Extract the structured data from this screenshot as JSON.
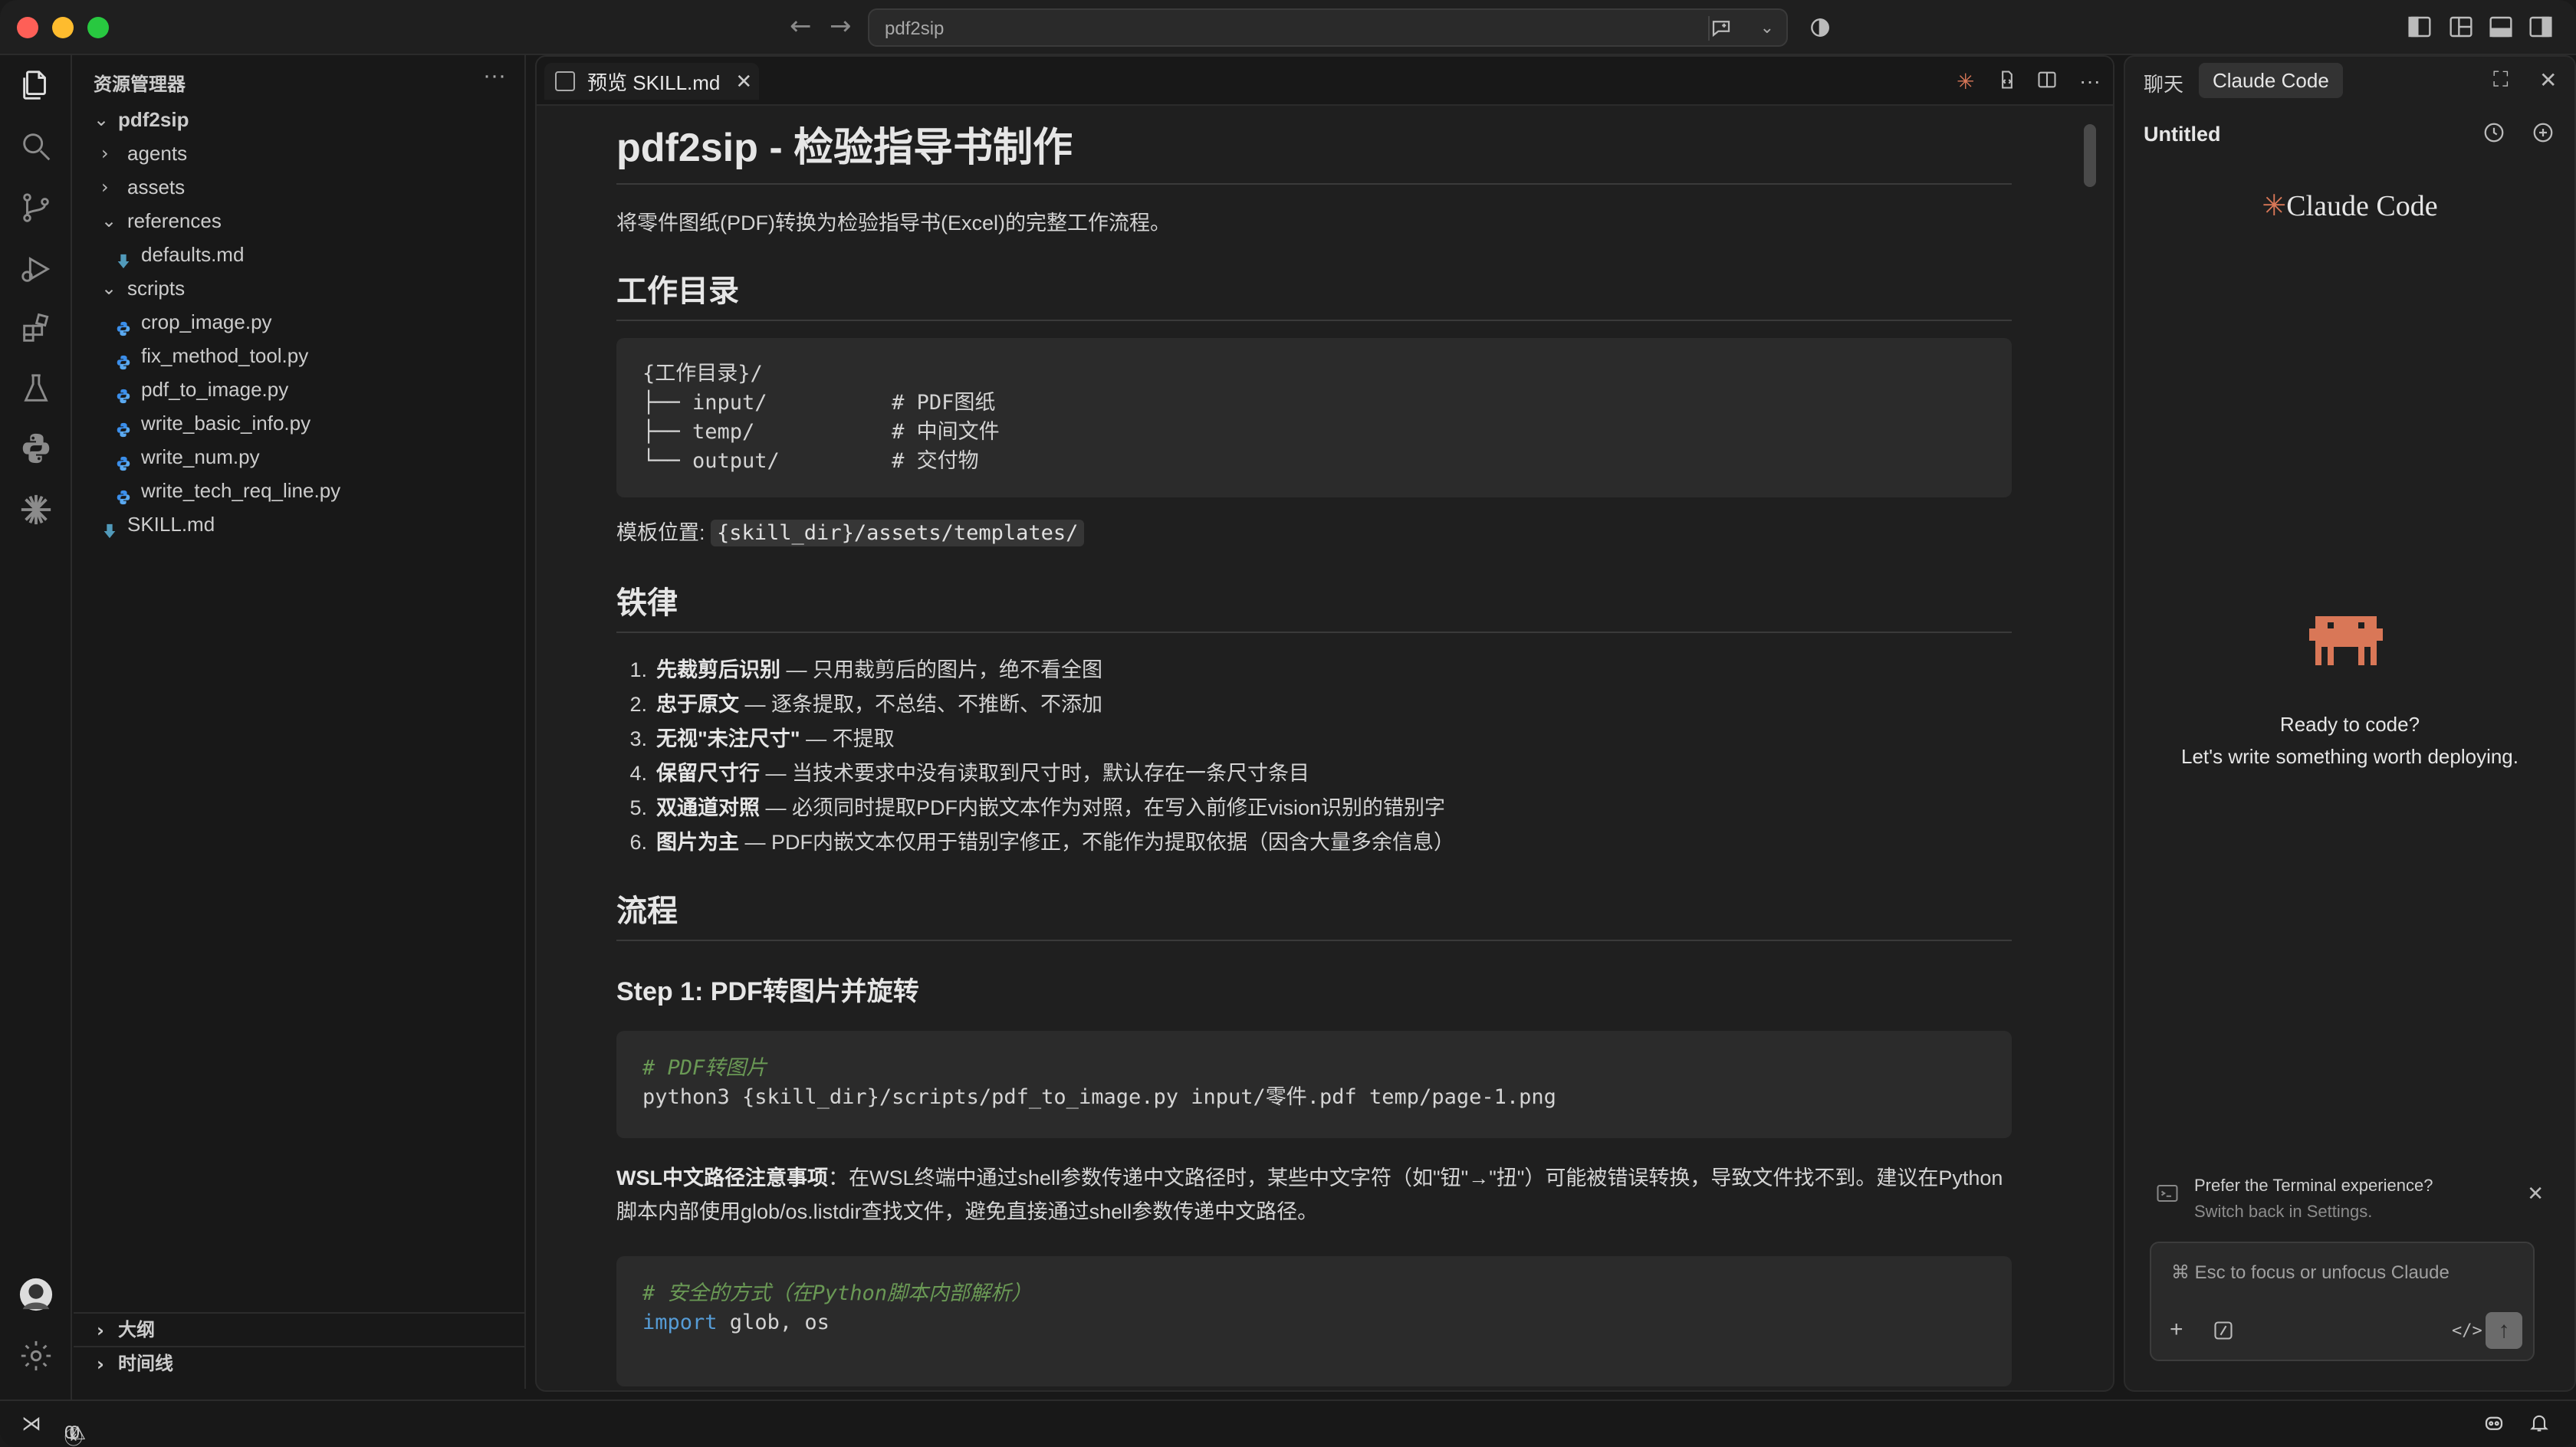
{
  "window": {
    "search_text": "pdf2sip"
  },
  "sidebar": {
    "title": "资源管理器",
    "root": "pdf2sip",
    "items": [
      {
        "label": "agents",
        "type": "folder",
        "level": 1,
        "expanded": false
      },
      {
        "label": "assets",
        "type": "folder",
        "level": 1,
        "expanded": false
      },
      {
        "label": "references",
        "type": "folder",
        "level": 1,
        "expanded": true
      },
      {
        "label": "defaults.md",
        "type": "md",
        "level": 2
      },
      {
        "label": "scripts",
        "type": "folder",
        "level": 1,
        "expanded": true
      },
      {
        "label": "crop_image.py",
        "type": "py",
        "level": 2
      },
      {
        "label": "fix_method_tool.py",
        "type": "py",
        "level": 2
      },
      {
        "label": "pdf_to_image.py",
        "type": "py",
        "level": 2
      },
      {
        "label": "write_basic_info.py",
        "type": "py",
        "level": 2
      },
      {
        "label": "write_num.py",
        "type": "py",
        "level": 2
      },
      {
        "label": "write_tech_req_line.py",
        "type": "py",
        "level": 2
      },
      {
        "label": "SKILL.md",
        "type": "md",
        "level": 1
      }
    ],
    "outline": "大纲",
    "timeline": "时间线"
  },
  "editor": {
    "tab_label": "预览 SKILL.md",
    "h1": "pdf2sip - 检验指导书制作",
    "intro": "将零件图纸(PDF)转换为检验指导书(Excel)的完整工作流程。",
    "h2_workdir": "工作目录",
    "workdir_code": "{工作目录}/\n├── input/          # PDF图纸\n├── temp/           # 中间文件\n└── output/         # 交付物",
    "template_label": "模板位置: ",
    "template_path": "{skill_dir}/assets/templates/",
    "h2_rules": "铁律",
    "rules": [
      {
        "num": "1.",
        "bold": "先裁剪后识别",
        "text": " — 只用裁剪后的图片，绝不看全图"
      },
      {
        "num": "2.",
        "bold": "忠于原文",
        "text": " — 逐条提取，不总结、不推断、不添加"
      },
      {
        "num": "3.",
        "bold": "无视\"未注尺寸\"",
        "text": " — 不提取"
      },
      {
        "num": "4.",
        "bold": "保留尺寸行",
        "text": " — 当技术要求中没有读取到尺寸时，默认存在一条尺寸条目"
      },
      {
        "num": "5.",
        "bold": "双通道对照",
        "text": " — 必须同时提取PDF内嵌文本作为对照，在写入前修正vision识别的错别字"
      },
      {
        "num": "6.",
        "bold": "图片为主",
        "text": " — PDF内嵌文本仅用于错别字修正，不能作为提取依据（因含大量多余信息）"
      }
    ],
    "h2_flow": "流程",
    "h3_step1": "Step 1: PDF转图片并旋转",
    "step1_comment": "# PDF转图片",
    "step1_cmd": "python3 {skill_dir}/scripts/pdf_to_image.py input/零件.pdf temp/page-1.png",
    "wsl_bold": "WSL中文路径注意事项",
    "wsl_text": "：在WSL终端中通过shell参数传递中文路径时，某些中文字符（如\"钮\"→\"扭\"）可能被错误转换，导致文件找不到。建议在Python脚本内部使用glob/os.listdir查找文件，避免直接通过shell参数传递中文路径。",
    "code2_comment": "# 安全的方式（在Python脚本内部解析）",
    "code2_kw": "import",
    "code2_rest": " glob, os"
  },
  "chat": {
    "tab_chat": "聊天",
    "tab_claude": "Claude Code",
    "session_title": "Untitled",
    "logo_text": "Claude Code",
    "ready_line1": "Ready to code?",
    "ready_line2": "Let's write something worth deploying.",
    "notice_title": "Prefer the Terminal experience?",
    "notice_sub": "Switch back in Settings.",
    "input_placeholder": "⌘ Esc to focus or unfocus Claude"
  },
  "status": {
    "errors": "0",
    "warnings": "0"
  },
  "colors": {
    "accent": "#d97757",
    "py_icon": "#3b8eea",
    "md_icon": "#519aba"
  }
}
